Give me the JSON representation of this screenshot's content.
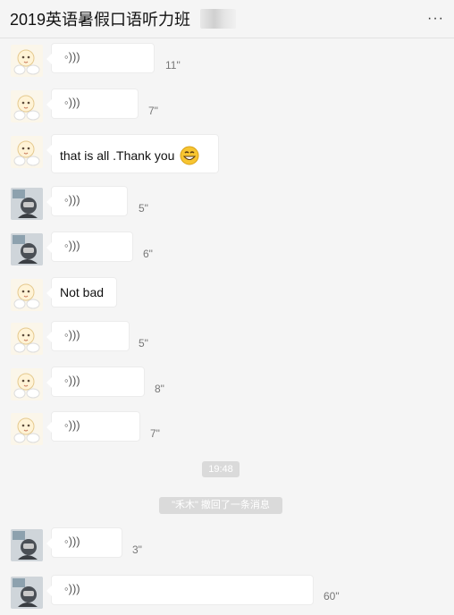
{
  "header": {
    "title": "2019英语暑假口语听力班",
    "more_icon": "more-dots-icon"
  },
  "messages": [
    {
      "sender": "a",
      "type": "voice",
      "duration": "11\""
    },
    {
      "sender": "a",
      "type": "voice",
      "duration": "7\""
    },
    {
      "sender": "a",
      "type": "text",
      "text": "that is all .Thank you",
      "emoji": "grinning-face-emoji"
    },
    {
      "sender": "b",
      "type": "voice",
      "duration": "5\""
    },
    {
      "sender": "b",
      "type": "voice",
      "duration": "6\""
    },
    {
      "sender": "a",
      "type": "text",
      "text": "Not bad"
    },
    {
      "sender": "a",
      "type": "voice",
      "duration": "5\""
    },
    {
      "sender": "a",
      "type": "voice",
      "duration": "8\""
    },
    {
      "sender": "a",
      "type": "voice",
      "duration": "7\""
    },
    {
      "sender": "b",
      "type": "voice",
      "duration": "3\""
    },
    {
      "sender": "b",
      "type": "voice",
      "duration": "60\""
    }
  ],
  "timestamp": "19:48",
  "system_notice": "\"禾木\" 撤回了一条消息"
}
